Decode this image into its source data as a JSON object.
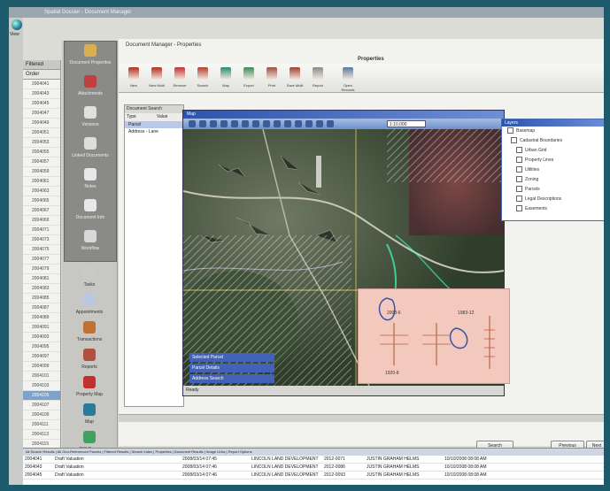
{
  "window": {
    "title": "Spatial Dossier - Document Manager"
  },
  "left": {
    "app_label": "View",
    "tab_label": "Filtered",
    "sort_label": "Order"
  },
  "directory_rows": [
    "2004041",
    "2004043",
    "2004045",
    "2004047",
    "2004049",
    "2004051",
    "2004053",
    "2004055",
    "2004057",
    "2004059",
    "2004061",
    "2004063",
    "2004065",
    "2004067",
    "2004069",
    "2004071",
    "2004073",
    "2004075",
    "2004077",
    "2004079",
    "2004081",
    "2004083",
    "2004085",
    "2004087",
    "2004089",
    "2004091",
    "2004093",
    "2004095",
    "2004097",
    "2004099",
    "2004101",
    "2004103",
    "2004105",
    "2004107",
    "2004109",
    "2004111",
    "2004113",
    "2004115",
    "2004117",
    "2004119",
    "2004121",
    "2004123",
    "2004125"
  ],
  "selected_row_index": 32,
  "toolbox": {
    "group_tools": [
      {
        "label": "Document Properties",
        "icon": "folder-icon",
        "color": "#d8b050"
      },
      {
        "label": "Attachments",
        "icon": "paperclip-icon",
        "color": "#c04040"
      },
      {
        "label": "Versions",
        "icon": "versions-icon",
        "color": "#e0e0e0"
      },
      {
        "label": "Linked Documents",
        "icon": "link-icon",
        "color": "#dddddd"
      },
      {
        "label": "Notes",
        "icon": "notes-icon",
        "color": "#e8e8e8"
      },
      {
        "label": "Document Info",
        "icon": "info-icon",
        "color": "#e8e8e8"
      },
      {
        "label": "Workflow",
        "icon": "workflow-icon",
        "color": "#d8d8d8"
      }
    ],
    "tools": [
      {
        "label": "Tasks",
        "icon": "tasks-icon",
        "color": "#c9c9c5"
      },
      {
        "label": "Appointments",
        "icon": "calendar-icon",
        "color": "#b9c8e0"
      },
      {
        "label": "Transactions",
        "icon": "transactions-icon",
        "color": "#c07030"
      },
      {
        "label": "Reports",
        "icon": "reports-icon",
        "color": "#b05040"
      },
      {
        "label": "Property Map",
        "icon": "property-icon",
        "color": "#c03030"
      },
      {
        "label": "Map",
        "icon": "globe-icon",
        "color": "#2a7a9a"
      },
      {
        "label": "GIS Query",
        "icon": "gis-icon",
        "color": "#40a060"
      }
    ]
  },
  "main": {
    "title": "Document Manager - Properties",
    "ribbon_label": "Properties",
    "ribbon_buttons": [
      {
        "label": "New",
        "color": "#b03020"
      },
      {
        "label": "New Multi",
        "color": "#b03020"
      },
      {
        "label": "Remove",
        "color": "#c03030"
      },
      {
        "label": "Search",
        "color": "#b04030"
      },
      {
        "label": "Map",
        "color": "#2a8a7a"
      },
      {
        "label": "Export",
        "color": "#3a8a5a"
      },
      {
        "label": "Print",
        "color": "#a05040"
      },
      {
        "label": "Save Multi",
        "color": "#a04030"
      },
      {
        "label": "Report",
        "color": "#8a8a8a"
      },
      {
        "label": "Open Records",
        "color": "#5a7a9a"
      }
    ]
  },
  "search_panel": {
    "title": "Document Search",
    "columns": [
      "Type",
      "Value"
    ],
    "rows": [
      "Parcel",
      "Address - Lane"
    ]
  },
  "map": {
    "title": "Map",
    "scale_value": "1:10,000",
    "layers_title": "Layers",
    "layers": [
      "Basemap",
      "Cadastral Boundaries",
      "Urban Grid",
      "Property Lines",
      "Utilities",
      "Zoning",
      "Parcels",
      "Legal Descriptions",
      "Easements"
    ],
    "overlay_labels": [
      "Selected Parcel",
      "Parcel Details",
      "Address Search"
    ],
    "parcel_labels": [
      "2003-6",
      "1983-12",
      "1920-8"
    ],
    "status": "Ready"
  },
  "footer_buttons": {
    "search": "Search",
    "previous": "Previous",
    "next": "Next"
  },
  "bottom_table": {
    "header": "All Search Results | All Geo-Referenced Parcels | Filtered Results | Search Index | Properties | Document Results | Image Links | Report Options",
    "rows": [
      [
        "2004041",
        "Draft Valuation",
        "2008/03/14 07:45",
        "LINCOLN LAND DEVELOPMENT",
        "2012-0071",
        "JUSTIN GRAHAM HELMS",
        "10/10/2008 08:08 AM"
      ],
      [
        "2004043",
        "Draft Valuation",
        "2008/03/14 07:46",
        "LINCOLN LAND DEVELOPMENT",
        "2012-0086",
        "JUSTIN GRAHAM HELMS",
        "10/10/2008 08:08 AM"
      ],
      [
        "2004045",
        "Draft Valuation",
        "2008/03/14 07:46",
        "LINCOLN LAND DEVELOPMENT",
        "2012-0093",
        "JUSTIN GRAHAM HELMS",
        "10/10/2008 08:08 AM"
      ]
    ]
  },
  "colors": {
    "background": "#1d5a6c",
    "accent": "#2b54b0",
    "selection": "#7fa3c8",
    "parcel_panel": "#f3c9bd"
  }
}
